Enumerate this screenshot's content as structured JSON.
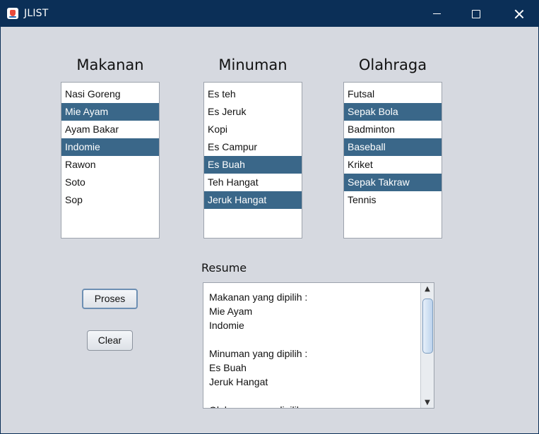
{
  "window": {
    "title": "JLIST"
  },
  "lists": [
    {
      "heading": "Makanan",
      "items": [
        {
          "label": "Nasi Goreng",
          "selected": false
        },
        {
          "label": "Mie Ayam",
          "selected": true
        },
        {
          "label": "Ayam Bakar",
          "selected": false
        },
        {
          "label": "Indomie",
          "selected": true
        },
        {
          "label": "Rawon",
          "selected": false
        },
        {
          "label": "Soto",
          "selected": false
        },
        {
          "label": "Sop",
          "selected": false
        }
      ]
    },
    {
      "heading": "Minuman",
      "items": [
        {
          "label": "Es teh",
          "selected": false
        },
        {
          "label": "Es Jeruk",
          "selected": false
        },
        {
          "label": "Kopi",
          "selected": false
        },
        {
          "label": "Es Campur",
          "selected": false
        },
        {
          "label": "Es Buah",
          "selected": true
        },
        {
          "label": "Teh Hangat",
          "selected": false
        },
        {
          "label": "Jeruk Hangat",
          "selected": true
        }
      ]
    },
    {
      "heading": "Olahraga",
      "items": [
        {
          "label": "Futsal",
          "selected": false
        },
        {
          "label": "Sepak Bola",
          "selected": true
        },
        {
          "label": "Badminton",
          "selected": false
        },
        {
          "label": "Baseball",
          "selected": true
        },
        {
          "label": "Kriket",
          "selected": false
        },
        {
          "label": "Sepak Takraw",
          "selected": true
        },
        {
          "label": "Tennis",
          "selected": false
        }
      ]
    }
  ],
  "buttons": {
    "proses": "Proses",
    "clear": "Clear"
  },
  "resume": {
    "label": "Resume",
    "text": "Makanan yang dipilih :\nMie Ayam\nIndomie\n\nMinuman yang dipilih :\nEs Buah\nJeruk Hangat\n\nOlahraga yang dipilih :"
  },
  "colors": {
    "titlebar": "#0b2f57",
    "selection": "#3a6789",
    "background": "#d6d9e0"
  }
}
